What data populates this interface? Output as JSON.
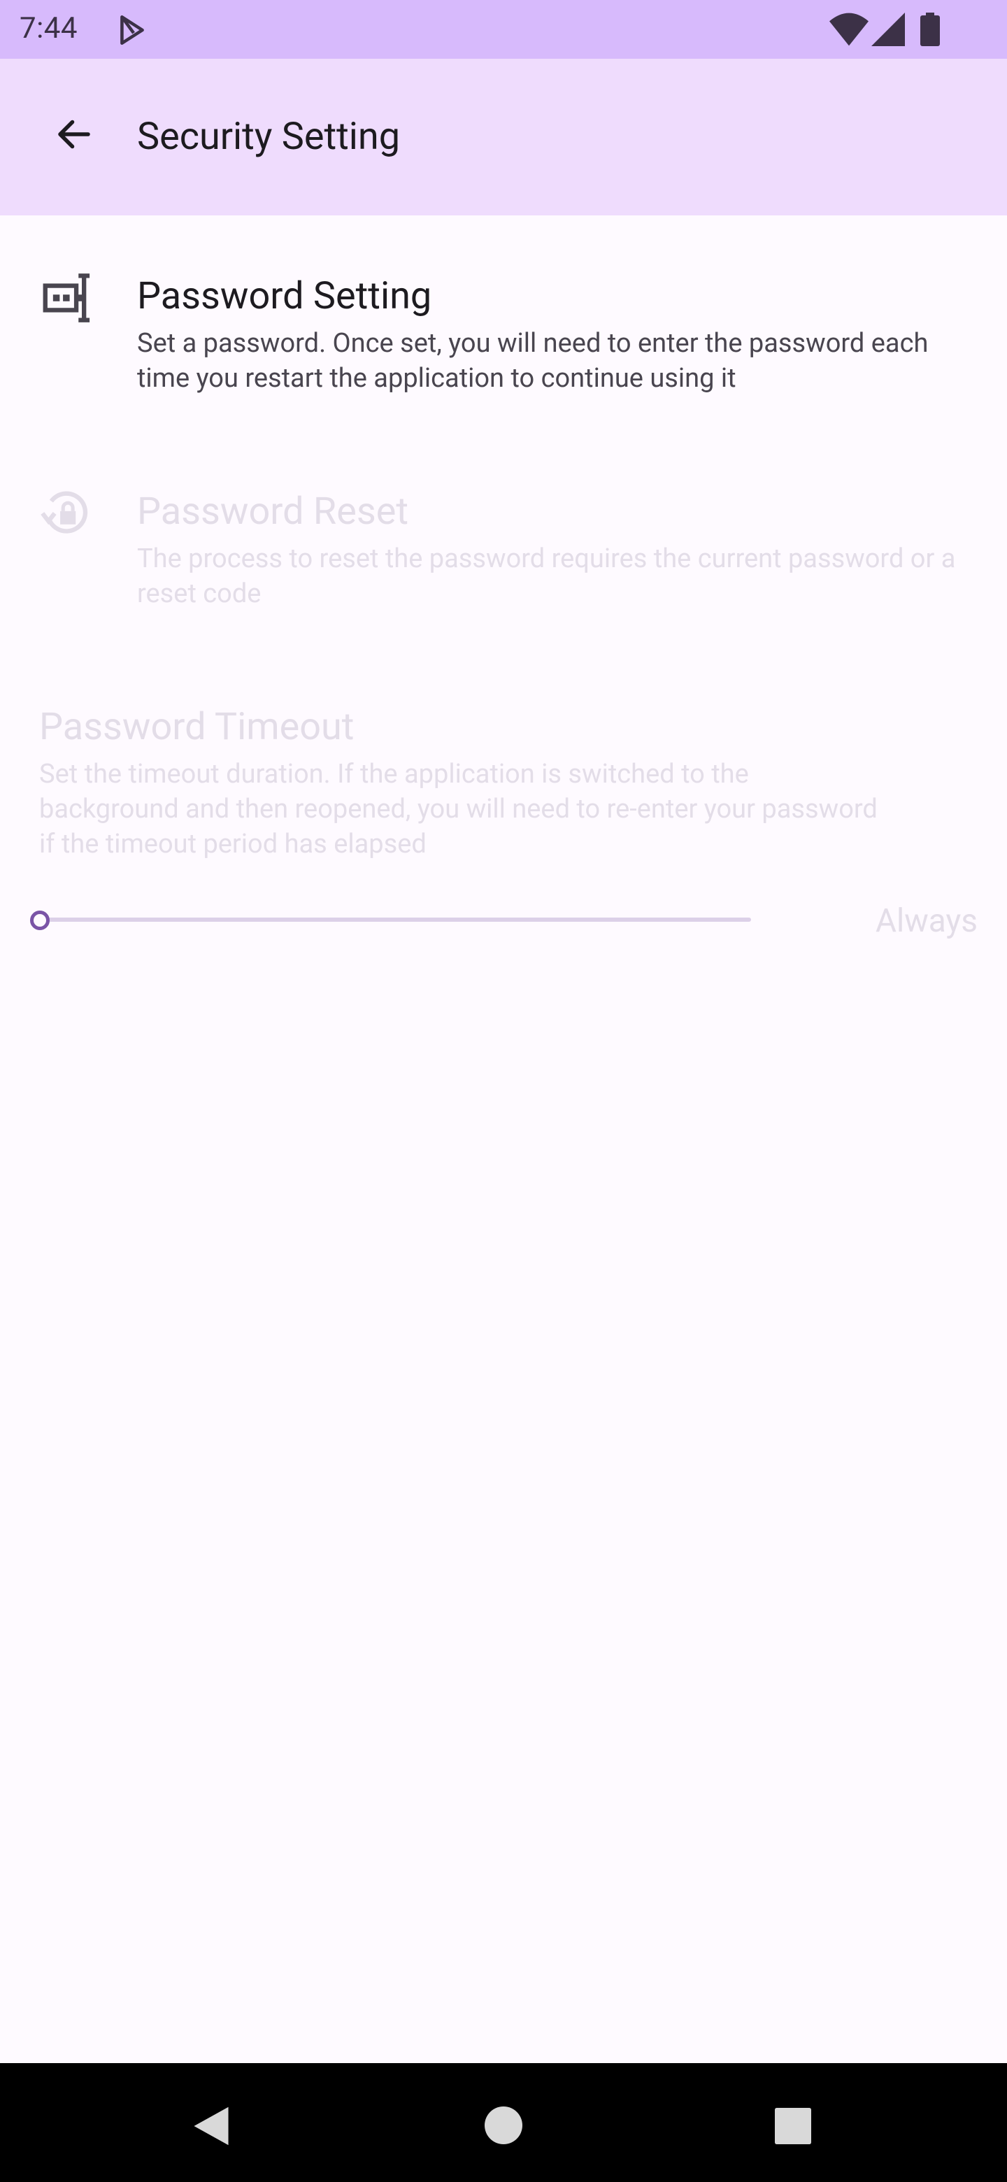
{
  "status_bar": {
    "time": "7:44",
    "icons": [
      "play-store-icon",
      "wifi-icon",
      "signal-icon",
      "battery-icon"
    ]
  },
  "app_bar": {
    "back_icon": "arrow-back-icon",
    "title": "Security Setting"
  },
  "settings": {
    "password_setting": {
      "icon": "password-icon",
      "title": "Password Setting",
      "description": "Set a password. Once set, you will need to enter the password each time you restart the application to continue using it",
      "enabled": true
    },
    "password_reset": {
      "icon": "lock-reset-icon",
      "title": "Password Reset",
      "description": "The process to reset the password requires the current password or a reset code",
      "enabled": false
    },
    "password_timeout": {
      "title": "Password Timeout",
      "description": "Set the timeout duration. If the application is switched to the background and then reopened, you will need to re-enter your password if the timeout period has elapsed",
      "enabled": false,
      "slider_value_label": "Always",
      "slider_fraction": 0
    }
  },
  "colors": {
    "status_bar": "#d7bafc",
    "app_bar": "#efdcfd",
    "background": "#fefaff",
    "accent": "#7a54a6",
    "disabled_text": "#e3dde8"
  },
  "nav_bar": {
    "buttons": [
      "back-triangle-icon",
      "home-circle-icon",
      "recents-square-icon"
    ]
  }
}
